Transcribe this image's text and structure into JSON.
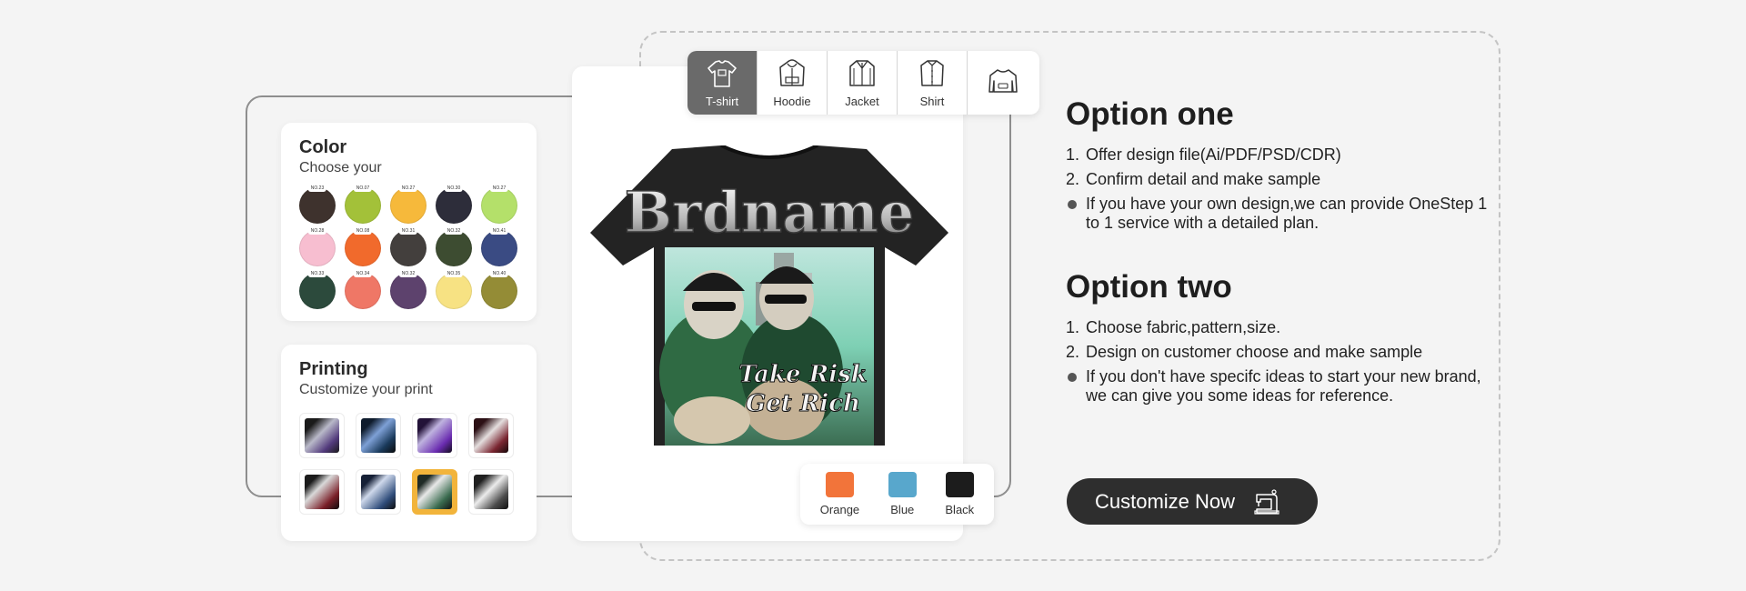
{
  "color_panel": {
    "title": "Color",
    "subtitle": "Choose your",
    "swatches": [
      {
        "tag": "NO.23",
        "color": "#3e322d"
      },
      {
        "tag": "NO.07",
        "color": "#a3c139"
      },
      {
        "tag": "NO.27",
        "color": "#f6b93b"
      },
      {
        "tag": "NO.30",
        "color": "#2d2d3a"
      },
      {
        "tag": "NO.27",
        "color": "#b4e06a"
      },
      {
        "tag": "NO.28",
        "color": "#f7bed0"
      },
      {
        "tag": "NO.08",
        "color": "#f16a2c"
      },
      {
        "tag": "NO.31",
        "color": "#433f3d"
      },
      {
        "tag": "NO.32",
        "color": "#3d4c31"
      },
      {
        "tag": "NO.41",
        "color": "#3a4b83"
      },
      {
        "tag": "NO.33",
        "color": "#2c4a3c"
      },
      {
        "tag": "NO.34",
        "color": "#ef7766"
      },
      {
        "tag": "NO.32",
        "color": "#5d426d"
      },
      {
        "tag": "NO.35",
        "color": "#f7e283"
      },
      {
        "tag": "NO.40",
        "color": "#948c36"
      }
    ]
  },
  "printing_panel": {
    "title": "Printing",
    "subtitle": "Customize your print",
    "selected_index": 6
  },
  "garment_tabs": [
    {
      "label": "T-shirt",
      "icon": "tshirt-icon"
    },
    {
      "label": "Hoodie",
      "icon": "hoodie-icon"
    },
    {
      "label": "Jacket",
      "icon": "jacket-icon"
    },
    {
      "label": "Shirt",
      "icon": "shirt-icon"
    },
    {
      "label": "",
      "icon": "sweatshirt-icon"
    }
  ],
  "shirt_colors": [
    {
      "label": "Orange",
      "color": "#f2743a"
    },
    {
      "label": "Blue",
      "color": "#58a7cc"
    },
    {
      "label": "Black",
      "color": "#1c1c1c"
    }
  ],
  "option_one": {
    "title": "Option one",
    "items": [
      {
        "marker": "1.",
        "text": "Offer design file(Ai/PDF/PSD/CDR)"
      },
      {
        "marker": "2.",
        "text": "Confirm detail and make sample"
      },
      {
        "marker": "•",
        "text": "If you have your own design,we can provide OneStep 1 to 1 service with a detailed plan."
      }
    ]
  },
  "option_two": {
    "title": "Option two",
    "items": [
      {
        "marker": "1.",
        "text": "Choose fabric,pattern,size."
      },
      {
        "marker": "2.",
        "text": "Design on customer choose and make sample"
      },
      {
        "marker": "•",
        "text": "If you don't have specifc ideas to start your new brand, we can give you some ideas for reference."
      }
    ]
  },
  "cta": {
    "label": "Customize Now",
    "icon": "sewing-machine-icon"
  },
  "preview": {
    "graphic_text_top": "Brdname",
    "graphic_text_bottom_1": "Take Risk",
    "graphic_text_bottom_2": "Get Rich"
  }
}
